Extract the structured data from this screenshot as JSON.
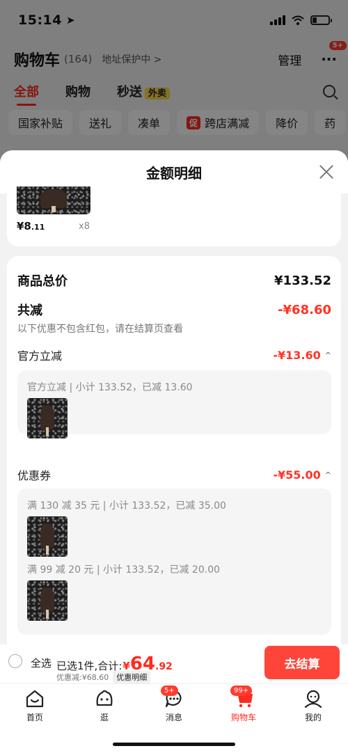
{
  "status_bar": {
    "time": "15:14"
  },
  "cart_header": {
    "title": "购物车",
    "count": "(164)",
    "address": "地址保护中 >",
    "manage": "管理",
    "more": "···",
    "more_badge": "5+"
  },
  "tabs": [
    {
      "label": "全部"
    },
    {
      "label": "购物"
    },
    {
      "label": "秒送",
      "badge": "外卖"
    }
  ],
  "chips": [
    {
      "label": "国家补贴"
    },
    {
      "label": "送礼"
    },
    {
      "label": "凑单"
    },
    {
      "label": "跨店满减",
      "tag": "促"
    },
    {
      "label": "降价"
    },
    {
      "label": "药"
    }
  ],
  "sheet": {
    "title": "金额明细",
    "top_item": {
      "price_int": "¥8",
      "price_dec": ".11",
      "qty": "x8"
    },
    "total_label": "商品总价",
    "total_value": "¥133.52",
    "reduce_label": "共减",
    "reduce_value": "-¥68.60",
    "reduce_note": "以下优惠不包含红包，请在结算页查看",
    "official_label": "官方立减",
    "official_value": "-¥13.60",
    "official_detail": "官方立减 | 小计 133.52，已减 13.60",
    "coupon_label": "优惠券",
    "coupon_value": "-¥55.00",
    "coupon_detail_1": "满 130 减 35 元 | 小计 133.52，已减 35.00",
    "coupon_detail_2": "满 99 减 20 元 | 小计 133.52，已减 20.00"
  },
  "checkout": {
    "select_all": "全选",
    "selected_text": "已选1件,合计:",
    "currency": "¥",
    "total_int": "64",
    "total_dec": ".92",
    "saved": "优惠减:¥68.60",
    "detail_button": "优惠明细",
    "pay_button": "去结算"
  },
  "tabbar": [
    {
      "label": "首页",
      "icon": "home-icon"
    },
    {
      "label": "逛",
      "icon": "face-icon"
    },
    {
      "label": "消息",
      "icon": "message-icon",
      "badge": "5+"
    },
    {
      "label": "购物车",
      "icon": "cart-icon",
      "badge": "99+",
      "active": true
    },
    {
      "label": "我的",
      "icon": "profile-icon"
    }
  ],
  "colors": {
    "accent": "#ff2a1f",
    "pay_button": "#ff4539",
    "discount": "#ff3324"
  }
}
